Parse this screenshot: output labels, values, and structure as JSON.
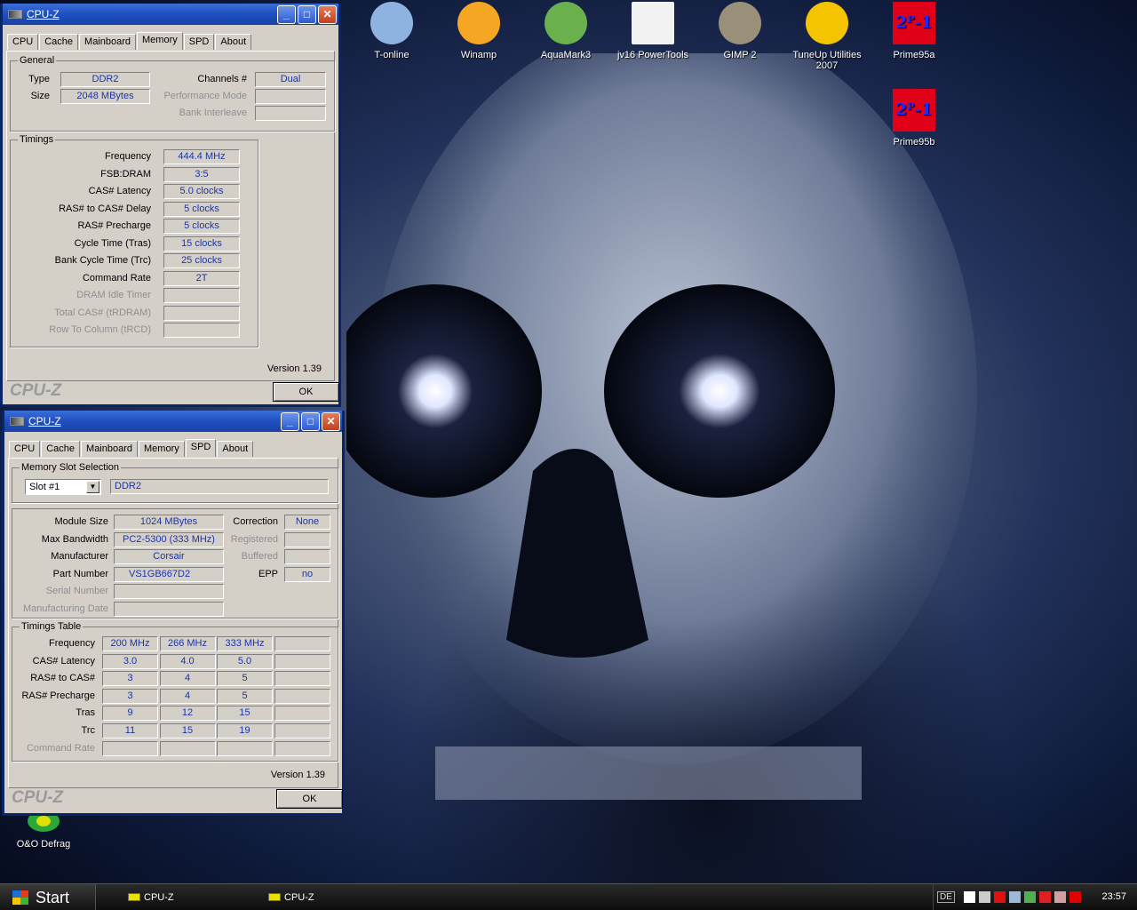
{
  "desktop": {
    "icons_top": [
      {
        "label": "T-online",
        "icon": "network-computer-icon"
      },
      {
        "label": "Winamp",
        "icon": "winamp-lightning-icon"
      },
      {
        "label": "AquaMark3",
        "icon": "aquamark-clover-icon"
      },
      {
        "label": "jv16 PowerTools",
        "icon": "lightbulb-icon"
      },
      {
        "label": "GIMP 2",
        "icon": "gimp-wilber-icon"
      },
      {
        "label": "TuneUp Utilities 2007",
        "icon": "tuneup-tools-icon"
      },
      {
        "label": "Prime95a",
        "icon": "prime95-icon"
      }
    ],
    "icon_prime95b": {
      "label": "Prime95b",
      "icon": "prime95-icon"
    },
    "icon_defrag": {
      "label": "O&O Defrag",
      "icon": "defrag-icon"
    },
    "prime_glyph": "2ᴾ-1"
  },
  "win1": {
    "title": "CPU-Z",
    "tabs": [
      "CPU",
      "Cache",
      "Mainboard",
      "Memory",
      "SPD",
      "About"
    ],
    "active_tab": "Memory",
    "general_label": "General",
    "type_label": "Type",
    "type_value": "DDR2",
    "size_label": "Size",
    "size_value": "2048 MBytes",
    "channels_label": "Channels #",
    "channels_value": "Dual",
    "perf_label": "Performance Mode",
    "perf_value": "",
    "bank_label": "Bank Interleave",
    "bank_value": "",
    "timings_label": "Timings",
    "timings": [
      {
        "label": "Frequency",
        "value": "444.4 MHz",
        "disabled": false
      },
      {
        "label": "FSB:DRAM",
        "value": "3:5",
        "disabled": false
      },
      {
        "label": "CAS# Latency",
        "value": "5.0 clocks",
        "disabled": false
      },
      {
        "label": "RAS# to CAS# Delay",
        "value": "5 clocks",
        "disabled": false
      },
      {
        "label": "RAS# Precharge",
        "value": "5 clocks",
        "disabled": false
      },
      {
        "label": "Cycle Time (Tras)",
        "value": "15 clocks",
        "disabled": false
      },
      {
        "label": "Bank Cycle Time (Trc)",
        "value": "25 clocks",
        "disabled": false
      },
      {
        "label": "Command Rate",
        "value": "2T",
        "disabled": false
      },
      {
        "label": "DRAM Idle Timer",
        "value": "",
        "disabled": true
      },
      {
        "label": "Total CAS# (tRDRAM)",
        "value": "",
        "disabled": true
      },
      {
        "label": "Row To Column (tRCD)",
        "value": "",
        "disabled": true
      }
    ],
    "version": "Version 1.39",
    "footer_logo": "CPU-Z",
    "ok_label": "OK"
  },
  "win2": {
    "title": "CPU-Z",
    "tabs": [
      "CPU",
      "Cache",
      "Mainboard",
      "Memory",
      "SPD",
      "About"
    ],
    "active_tab": "SPD",
    "slot_group_label": "Memory Slot Selection",
    "slot_selected": "Slot #1",
    "slot_type": "DDR2",
    "module_size_label": "Module Size",
    "module_size": "1024 MBytes",
    "max_bw_label": "Max Bandwidth",
    "max_bw": "PC2-5300 (333 MHz)",
    "manufacturer_label": "Manufacturer",
    "manufacturer": "Corsair",
    "part_label": "Part Number",
    "part": "VS1GB667D2",
    "serial_label": "Serial Number",
    "serial": "",
    "mfg_date_label": "Manufacturing Date",
    "mfg_date": "",
    "correction_label": "Correction",
    "correction": "None",
    "registered_label": "Registered",
    "registered": "",
    "buffered_label": "Buffered",
    "buffered": "",
    "epp_label": "EPP",
    "epp": "no",
    "timings_table_label": "Timings Table",
    "table": [
      {
        "label": "Frequency",
        "cells": [
          "200 MHz",
          "266 MHz",
          "333 MHz",
          ""
        ],
        "disabled": false
      },
      {
        "label": "CAS# Latency",
        "cells": [
          "3.0",
          "4.0",
          "5.0",
          ""
        ],
        "disabled": false
      },
      {
        "label": "RAS# to CAS#",
        "cells": [
          "3",
          "4",
          "5",
          ""
        ],
        "disabled": false
      },
      {
        "label": "RAS# Precharge",
        "cells": [
          "3",
          "4",
          "5",
          ""
        ],
        "disabled": false
      },
      {
        "label": "Tras",
        "cells": [
          "9",
          "12",
          "15",
          ""
        ],
        "disabled": false
      },
      {
        "label": "Trc",
        "cells": [
          "11",
          "15",
          "19",
          ""
        ],
        "disabled": false
      },
      {
        "label": "Command Rate",
        "cells": [
          "",
          "",
          "",
          ""
        ],
        "disabled": true
      }
    ],
    "version": "Version 1.39",
    "footer_logo": "CPU-Z",
    "ok_label": "OK"
  },
  "taskbar": {
    "start_label": "Start",
    "tasks": [
      "CPU-Z",
      "CPU-Z"
    ],
    "lang": "DE",
    "clock": "23:57",
    "tray_icons": [
      "diamond-icon",
      "cpu-z-tray-icon",
      "ati-icon",
      "network-icon",
      "shield-icon",
      "meter-icon",
      "flag-icon",
      "antivirus-icon"
    ]
  }
}
